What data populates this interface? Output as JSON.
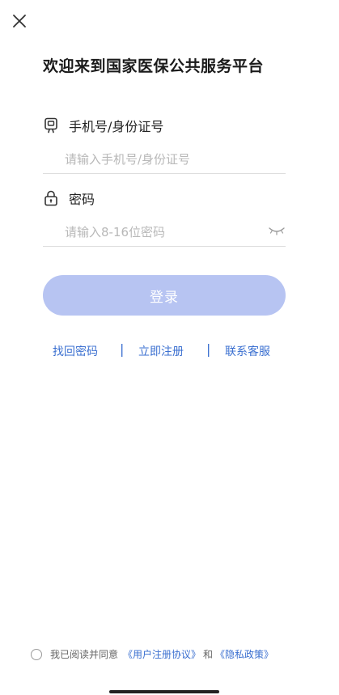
{
  "title": "欢迎来到国家医保公共服务平台",
  "phone_field": {
    "label": "手机号/身份证号",
    "placeholder": "请输入手机号/身份证号",
    "icon": "phone-icon"
  },
  "password_field": {
    "label": "密码",
    "placeholder": "请输入8-16位密码",
    "icon": "lock-icon",
    "toggle_icon": "eye-closed-icon"
  },
  "login_button": {
    "label": "登录",
    "color": "#b7c4f2"
  },
  "links": {
    "recover": "找回密码",
    "register": "立即注册",
    "contact": "联系客服",
    "separator": "|",
    "color": "#3a6fd0"
  },
  "footer": {
    "prefix": "我已阅读并同意",
    "user_agreement": "《用户注册协议》",
    "conjunction": "和",
    "privacy_policy": "《隐私政策》"
  }
}
